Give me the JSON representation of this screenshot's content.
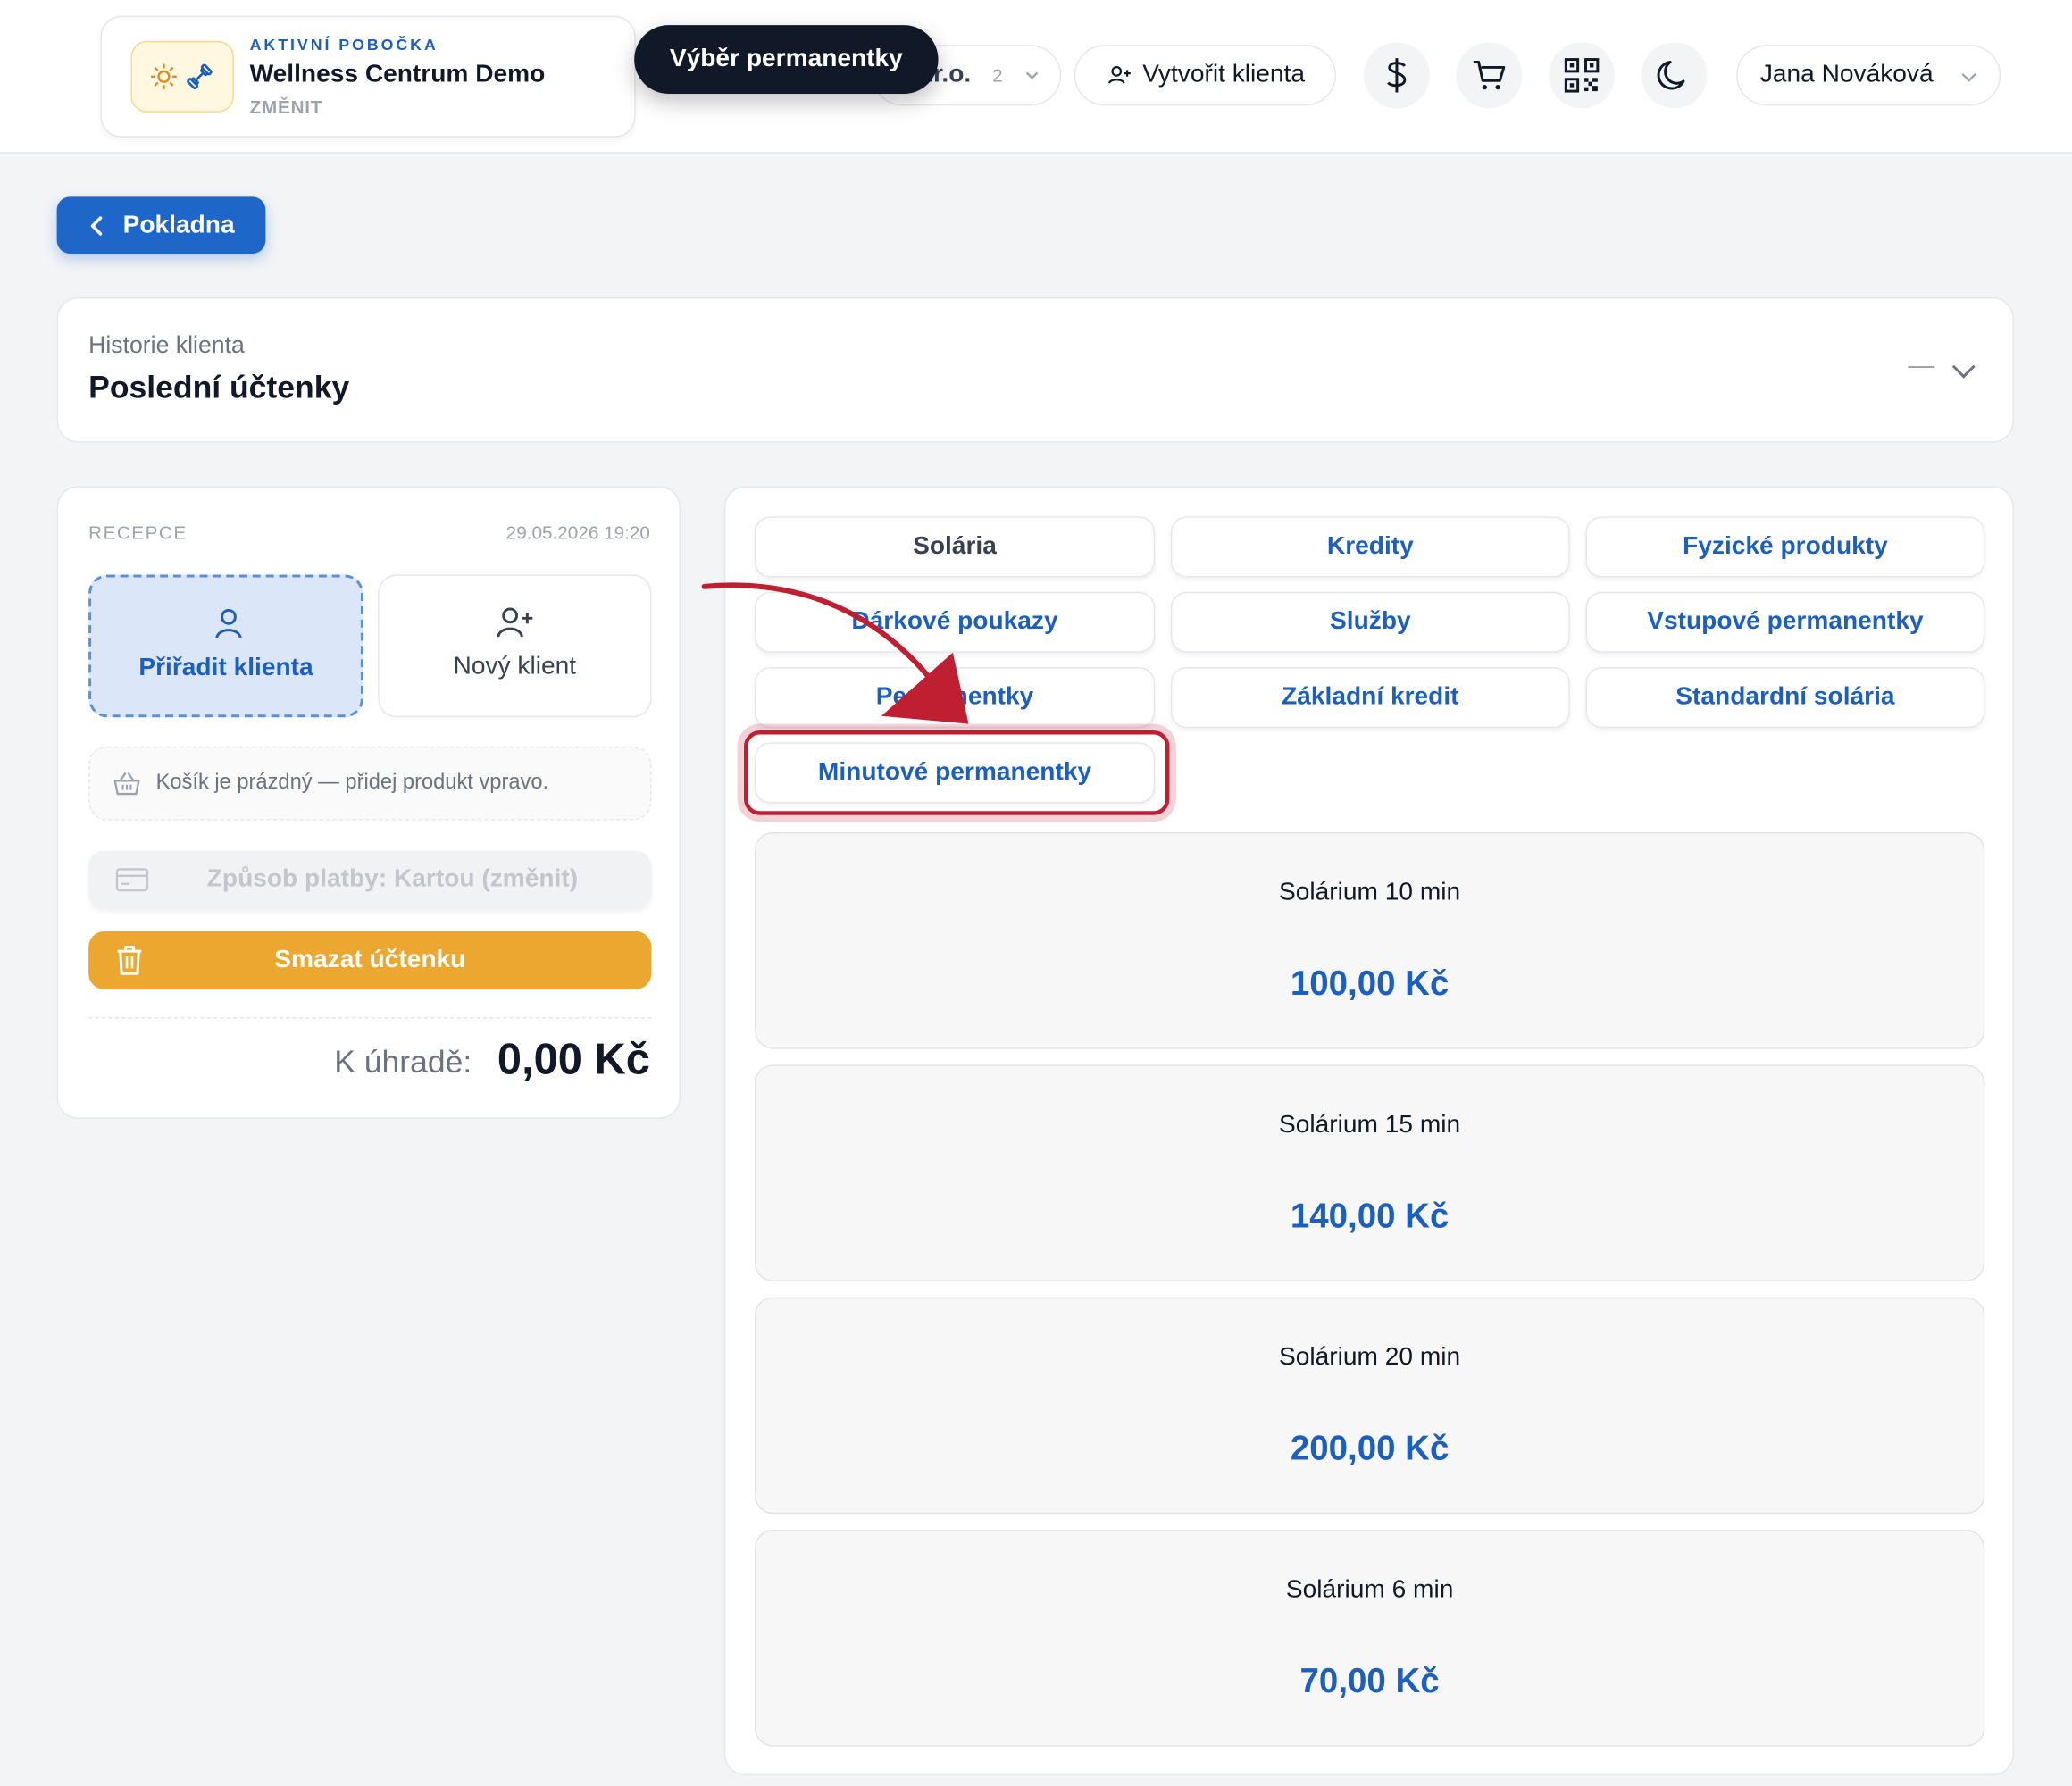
{
  "header": {
    "branch": {
      "eyebrow": "AKTIVNÍ POBOČKA",
      "name": "Wellness Centrum Demo",
      "change_label": "ZMĚNIT"
    },
    "tooltip": "Výběr permanentky",
    "company": {
      "text": ".r.o.",
      "count": "2"
    },
    "create_client_label": "Vytvořit klienta",
    "user_name": "Jana Nováková",
    "icons": {
      "currency": "dollar-icon",
      "cart": "cart-icon",
      "qr": "qr-code-icon",
      "theme": "moon-icon"
    }
  },
  "back_button": {
    "label": "Pokladna"
  },
  "history": {
    "subtitle": "Historie klienta",
    "title": "Poslední účtenky",
    "dash": "—"
  },
  "receipt": {
    "label": "RECEPCE",
    "datetime": "29.05.2026 19:20",
    "assign_client": "Přiřadit klienta",
    "new_client": "Nový klient",
    "empty_cart": "Košík je prázdný — přidej produkt vpravo.",
    "payment": "Způsob platby: Kartou (změnit)",
    "delete": "Smazat účtenku",
    "total_label": "K úhradě:",
    "total_value": "0,00 Kč"
  },
  "catalog": {
    "tabs": [
      "Solária",
      "Kredity",
      "Fyzické produkty",
      "Dárkové poukazy",
      "Služby",
      "Vstupové permanentky",
      "Permanentky",
      "Základní kredit",
      "Standardní solária",
      "Minutové permanentky"
    ],
    "products": [
      {
        "name": "Solárium 10 min",
        "price": "100,00 Kč"
      },
      {
        "name": "Solárium 15 min",
        "price": "140,00 Kč"
      },
      {
        "name": "Solárium 20 min",
        "price": "200,00 Kč"
      },
      {
        "name": "Solárium 6 min",
        "price": "70,00 Kč"
      }
    ]
  },
  "colors": {
    "accent": "#1f66c9",
    "warning": "#eba730",
    "highlight": "#c01f32",
    "tooltip": "#111827"
  }
}
